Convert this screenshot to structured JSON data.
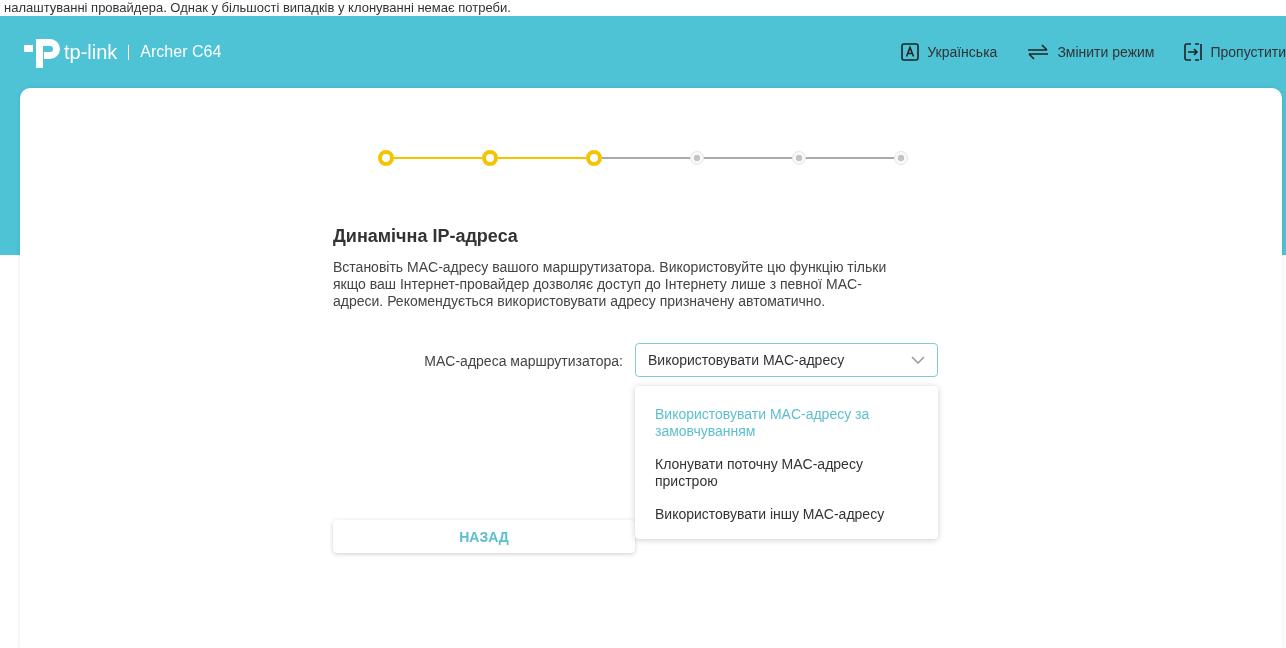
{
  "caption": "налаштуванні провайдера. Однак у більшості випадків у клонуванні немає потреби.",
  "header": {
    "brand": "tp-link",
    "model": "Archer C64",
    "actions": [
      {
        "kind": "language",
        "label": "Українська"
      },
      {
        "kind": "mode",
        "label": "Змінити режим"
      },
      {
        "kind": "skip",
        "label": "Пропустити"
      }
    ]
  },
  "steps": [
    {
      "completed": true
    },
    {
      "completed": true
    },
    {
      "completed": true
    },
    {
      "completed": false
    },
    {
      "completed": false
    },
    {
      "completed": false
    }
  ],
  "title": "Динамічна IP-адреса",
  "description": "Встановіть MAC-адресу вашого маршрутизатора. Використовуйте цю функцію тільки якщо ваш Інтернет-провайдер дозволяє доступ до Інтернету лише з певної MAC-адреси. Рекомендується використовувати адресу призначену автоматично.",
  "mac_field": {
    "label": "MAC-адреса маршрутизатора:",
    "value": "Використовувати MAC-адресу",
    "options": [
      {
        "label": "Використовувати MAC-адресу за замовчуванням",
        "selected": true
      },
      {
        "label": "Клонувати поточну MAC-адресу пристрою",
        "selected": false
      },
      {
        "label": "Використовувати іншу MAC-адресу",
        "selected": false
      }
    ]
  },
  "buttons": [
    "НАЗАД"
  ]
}
